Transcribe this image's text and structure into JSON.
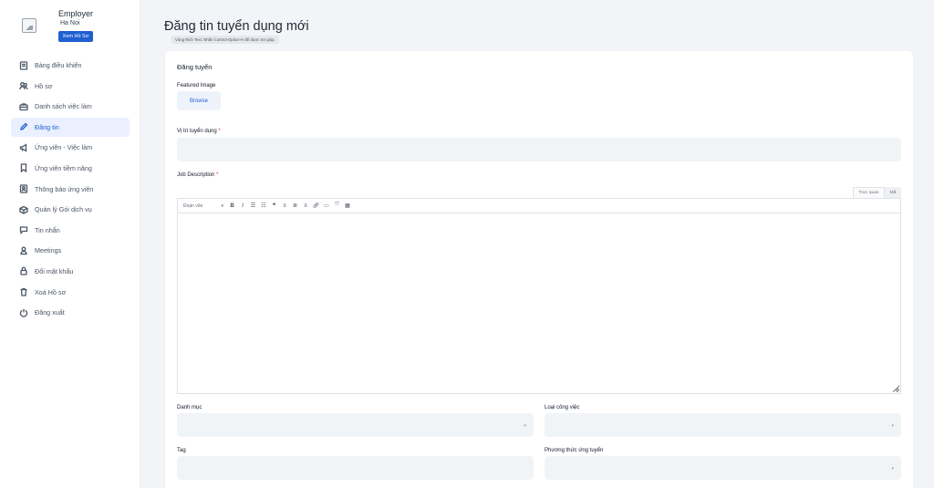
{
  "profile": {
    "name": "Employer",
    "city": "Ha Noi",
    "view_button": "Xem Hồ Sơ",
    "avatar_icon": "image-placeholder-icon"
  },
  "nav": {
    "items": [
      {
        "label": "Bảng điều khiển",
        "icon": "dashboard-icon"
      },
      {
        "label": "Hồ sơ",
        "icon": "profile-icon"
      },
      {
        "label": "Danh sách việc làm",
        "icon": "briefcase-icon"
      },
      {
        "label": "Đăng tin",
        "icon": "pencil-icon",
        "active": true
      },
      {
        "label": "Ứng viên - Việc làm",
        "icon": "megaphone-icon"
      },
      {
        "label": "Ứng viên tiềm năng",
        "icon": "bookmark-icon"
      },
      {
        "label": "Thông báo ứng viên",
        "icon": "notification-icon"
      },
      {
        "label": "Quản lý Gói dịch vụ",
        "icon": "package-icon"
      },
      {
        "label": "Tin nhắn",
        "icon": "chat-icon"
      },
      {
        "label": "Meetings",
        "icon": "meeting-icon"
      },
      {
        "label": "Đổi mật khẩu",
        "icon": "lock-icon"
      },
      {
        "label": "Xoá Hồ sơ",
        "icon": "trash-icon"
      },
      {
        "label": "Đăng xuất",
        "icon": "logout-icon"
      }
    ]
  },
  "header": {
    "title": "Đăng tin tuyển dụng mới",
    "tooltip": "Vùng Rich Text. Nhấn Control-Option-H để được trợ giúp."
  },
  "form": {
    "section_title": "Đăng tuyển",
    "featured_image_label": "Featured Image",
    "browse_label": "Browse",
    "position_label": "Vị trí tuyển dụng",
    "job_description_label": "Job Description",
    "required_mark": "*",
    "editor": {
      "tab_visual": "Trực quan",
      "tab_code": "Mã",
      "format_select": "Đoạn văn",
      "tools": [
        "bold-icon",
        "italic-icon",
        "bullet-list-icon",
        "numbered-list-icon",
        "blockquote-icon",
        "align-left-icon",
        "align-center-icon",
        "align-right-icon",
        "link-icon",
        "more-tag-icon",
        "fullscreen-icon",
        "kitchen-sink-icon"
      ]
    },
    "category_label": "Danh mục",
    "job_type_label": "Loại công việc",
    "tag_label": "Tag",
    "apply_method_label": "Phương thức ứng tuyển"
  },
  "colors": {
    "accent": "#1f5fd1",
    "active_bg": "#eaf0ff",
    "field_bg": "#f1f4f7",
    "required": "#e11d48"
  }
}
